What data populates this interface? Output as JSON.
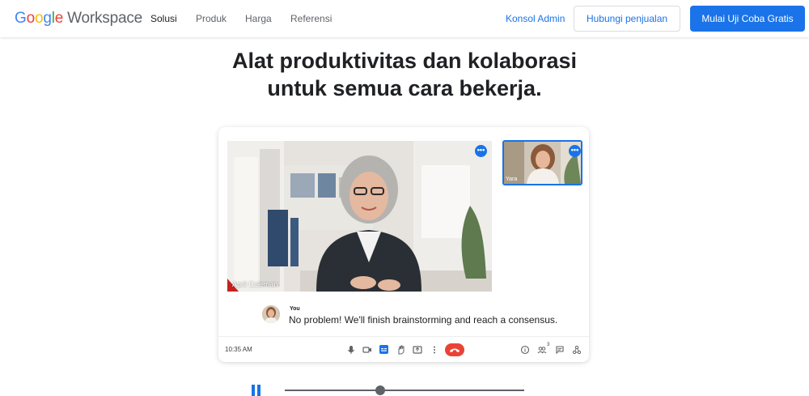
{
  "header": {
    "logo_letters": [
      "G",
      "o",
      "o",
      "g",
      "l",
      "e"
    ],
    "logo_product": "Workspace",
    "nav": [
      "Solusi",
      "Produk",
      "Harga",
      "Referensi"
    ],
    "admin_link": "Konsol Admin",
    "contact_button": "Hubungi penjualan",
    "trial_button": "Mulai Uji Coba Gratis"
  },
  "hero": {
    "line1": "Alat produktivitas dan kolaborasi",
    "line2": "untuk semua cara bekerja."
  },
  "meet": {
    "main_participant": "April Coleman",
    "thumb_participant": "Yara",
    "chat_sender": "You",
    "chat_message": "No problem! We'll finish brainstorming and reach a consensus.",
    "time": "10:35 AM",
    "people_count": "3",
    "more_glyph": "•••",
    "tools": [
      "mic-icon",
      "camera-icon",
      "captions-icon",
      "raise-hand-icon",
      "present-icon",
      "more-options-icon"
    ],
    "right_tools": [
      "info-icon",
      "people-icon",
      "chat-icon",
      "activities-icon"
    ]
  },
  "player": {
    "progress": 0.4
  },
  "colors": {
    "accent": "#1a73e8",
    "end_call": "#ea4335",
    "text": "#202124"
  }
}
